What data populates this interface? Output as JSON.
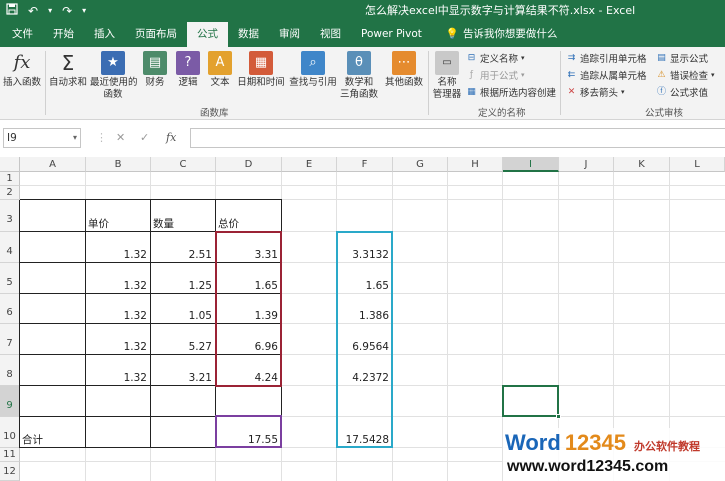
{
  "app": {
    "title": "怎么解决excel中显示数字与计算结果不符.xlsx  -  Excel",
    "tabs": [
      "文件",
      "开始",
      "插入",
      "页面布局",
      "公式",
      "数据",
      "审阅",
      "视图",
      "Power Pivot"
    ],
    "active_tab": "公式",
    "tell_me": "告诉我你想要做什么"
  },
  "ribbon": {
    "insert_function": "插入函数",
    "autosum": "自动求和",
    "recent_1": "最近使用的",
    "recent_2": "函数",
    "financial": "财务",
    "logical": "逻辑",
    "text": "文本",
    "datetime": "日期和时间",
    "lookup": "查找与引用",
    "math_1": "数学和",
    "math_2": "三角函数",
    "more": "其他函数",
    "group_library": "函数库",
    "name_manager_1": "名称",
    "name_manager_2": "管理器",
    "define_name": "定义名称",
    "use_in_formula": "用于公式",
    "create_from_selection": "根据所选内容创建",
    "group_names": "定义的名称",
    "trace_precedents": "追踪引用单元格",
    "trace_dependents": "追踪从属单元格",
    "remove_arrows": "移去箭头",
    "show_formulas": "显示公式",
    "error_checking": "错误检查",
    "evaluate_formula": "公式求值",
    "group_audit": "公式审核"
  },
  "formula_bar": {
    "name_box": "I9",
    "cancel": "✕",
    "enter": "✓",
    "fx": "fx",
    "value": ""
  },
  "columns": [
    "A",
    "B",
    "C",
    "D",
    "E",
    "F",
    "G",
    "H",
    "I",
    "J",
    "K",
    "L"
  ],
  "rows": [
    "1",
    "2",
    "3",
    "4",
    "5",
    "6",
    "7",
    "8",
    "9",
    "10",
    "11",
    "12"
  ],
  "selected_col": "I",
  "selected_row": "9",
  "cells": {
    "B3": "单价",
    "C3": "数量",
    "D3": "总价",
    "B4": "1.32",
    "C4": "2.51",
    "D4": "3.31",
    "F4": "3.3132",
    "B5": "1.32",
    "C5": "1.25",
    "D5": "1.65",
    "F5": "1.65",
    "B6": "1.32",
    "C6": "1.05",
    "D6": "1.39",
    "F6": "1.386",
    "B7": "1.32",
    "C7": "5.27",
    "D7": "6.96",
    "F7": "6.9564",
    "B8": "1.32",
    "C8": "3.21",
    "D8": "4.24",
    "F8": "4.2372",
    "A10": "合计",
    "D10": "17.55",
    "F10": "17.5428"
  },
  "watermark": {
    "brand_word": "Word",
    "brand_num": "12345",
    "tagline": "办公软件教程",
    "url": "www.word12345.com"
  },
  "colors": {
    "excel_green": "#217346",
    "box_red": "#9b2335",
    "box_blue": "#2aa9c9",
    "box_purple": "#7b3fa0"
  }
}
